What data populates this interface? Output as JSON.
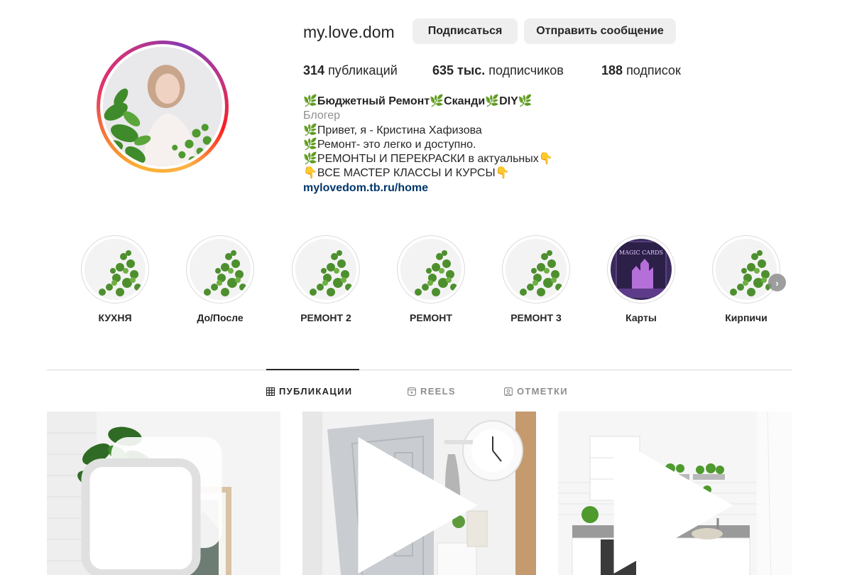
{
  "profile": {
    "username": "my.love.dom",
    "follow_label": "Подписаться",
    "message_label": "Отправить сообщение",
    "stats": {
      "posts_count": "314",
      "posts_label": "публикаций",
      "followers_count": "635 тыс.",
      "followers_label": "подписчиков",
      "following_count": "188",
      "following_label": "подписок"
    },
    "bio": {
      "name_lines": [
        "Бюджетный Ремонт",
        "Сканди",
        "DIY"
      ],
      "category": "Блогер",
      "line1": "Привет, я - Кристина Хафизова",
      "line2": "Ремонт- это легко и доступно.",
      "line3": "РЕМОНТЫ И ПЕРЕКРАСКИ в актуальных",
      "line4": "ВСЕ МАСТЕР КЛАССЫ И КУРСЫ",
      "link": "mylovedom.tb.ru/home"
    }
  },
  "highlights": [
    {
      "label": "КУХНЯ",
      "icon": "plant-image"
    },
    {
      "label": "До/После",
      "icon": "plant-image"
    },
    {
      "label": "РЕМОНТ 2",
      "icon": "plant-image"
    },
    {
      "label": "РЕМОНТ",
      "icon": "plant-image"
    },
    {
      "label": "РЕМОНТ 3",
      "icon": "plant-image"
    },
    {
      "label": "Карты",
      "icon": "magic-cards-image"
    },
    {
      "label": "Кирпичи",
      "icon": "plant-image"
    }
  ],
  "tabs": [
    {
      "label": "ПУБЛИКАЦИИ",
      "icon": "grid-icon",
      "active": true
    },
    {
      "label": "REELS",
      "icon": "reels-icon",
      "active": false
    },
    {
      "label": "ОТМЕТКИ",
      "icon": "tagged-icon",
      "active": false
    }
  ],
  "posts": [
    {
      "type": "carousel",
      "icon": "carousel-icon"
    },
    {
      "type": "reel",
      "icon": "play-icon"
    },
    {
      "type": "reel",
      "icon": "play-icon"
    }
  ],
  "colors": {
    "text": "#262626",
    "secondary": "#8e8e8e",
    "link": "#00376b",
    "button_bg": "#efefef",
    "divider": "#dbdbdb"
  }
}
